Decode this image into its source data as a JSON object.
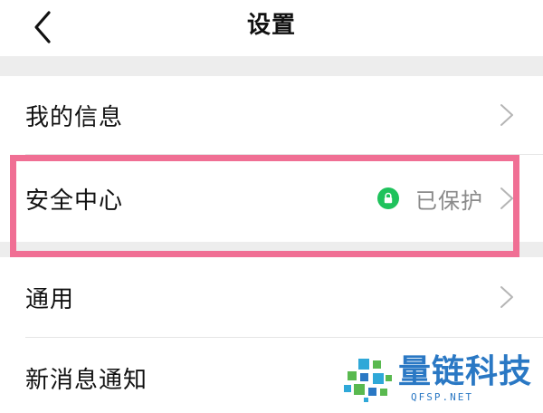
{
  "header": {
    "title": "设置",
    "back_icon": "chevron-left-icon"
  },
  "settings": {
    "items": [
      {
        "label": "我的信息",
        "chevron_icon": "chevron-right-icon"
      },
      {
        "label": "安全中心",
        "status_icon": "lock-icon",
        "status_color": "#1fc25c",
        "status_text": "已保护",
        "chevron_icon": "chevron-right-icon"
      },
      {
        "label": "通用",
        "chevron_icon": "chevron-right-icon"
      },
      {
        "label": "新消息通知"
      }
    ]
  },
  "annotation": {
    "highlight_color": "#f06f94"
  },
  "watermark": {
    "brand": "量链科技",
    "url": "QFSP.NET",
    "color": "#2a78c4"
  }
}
